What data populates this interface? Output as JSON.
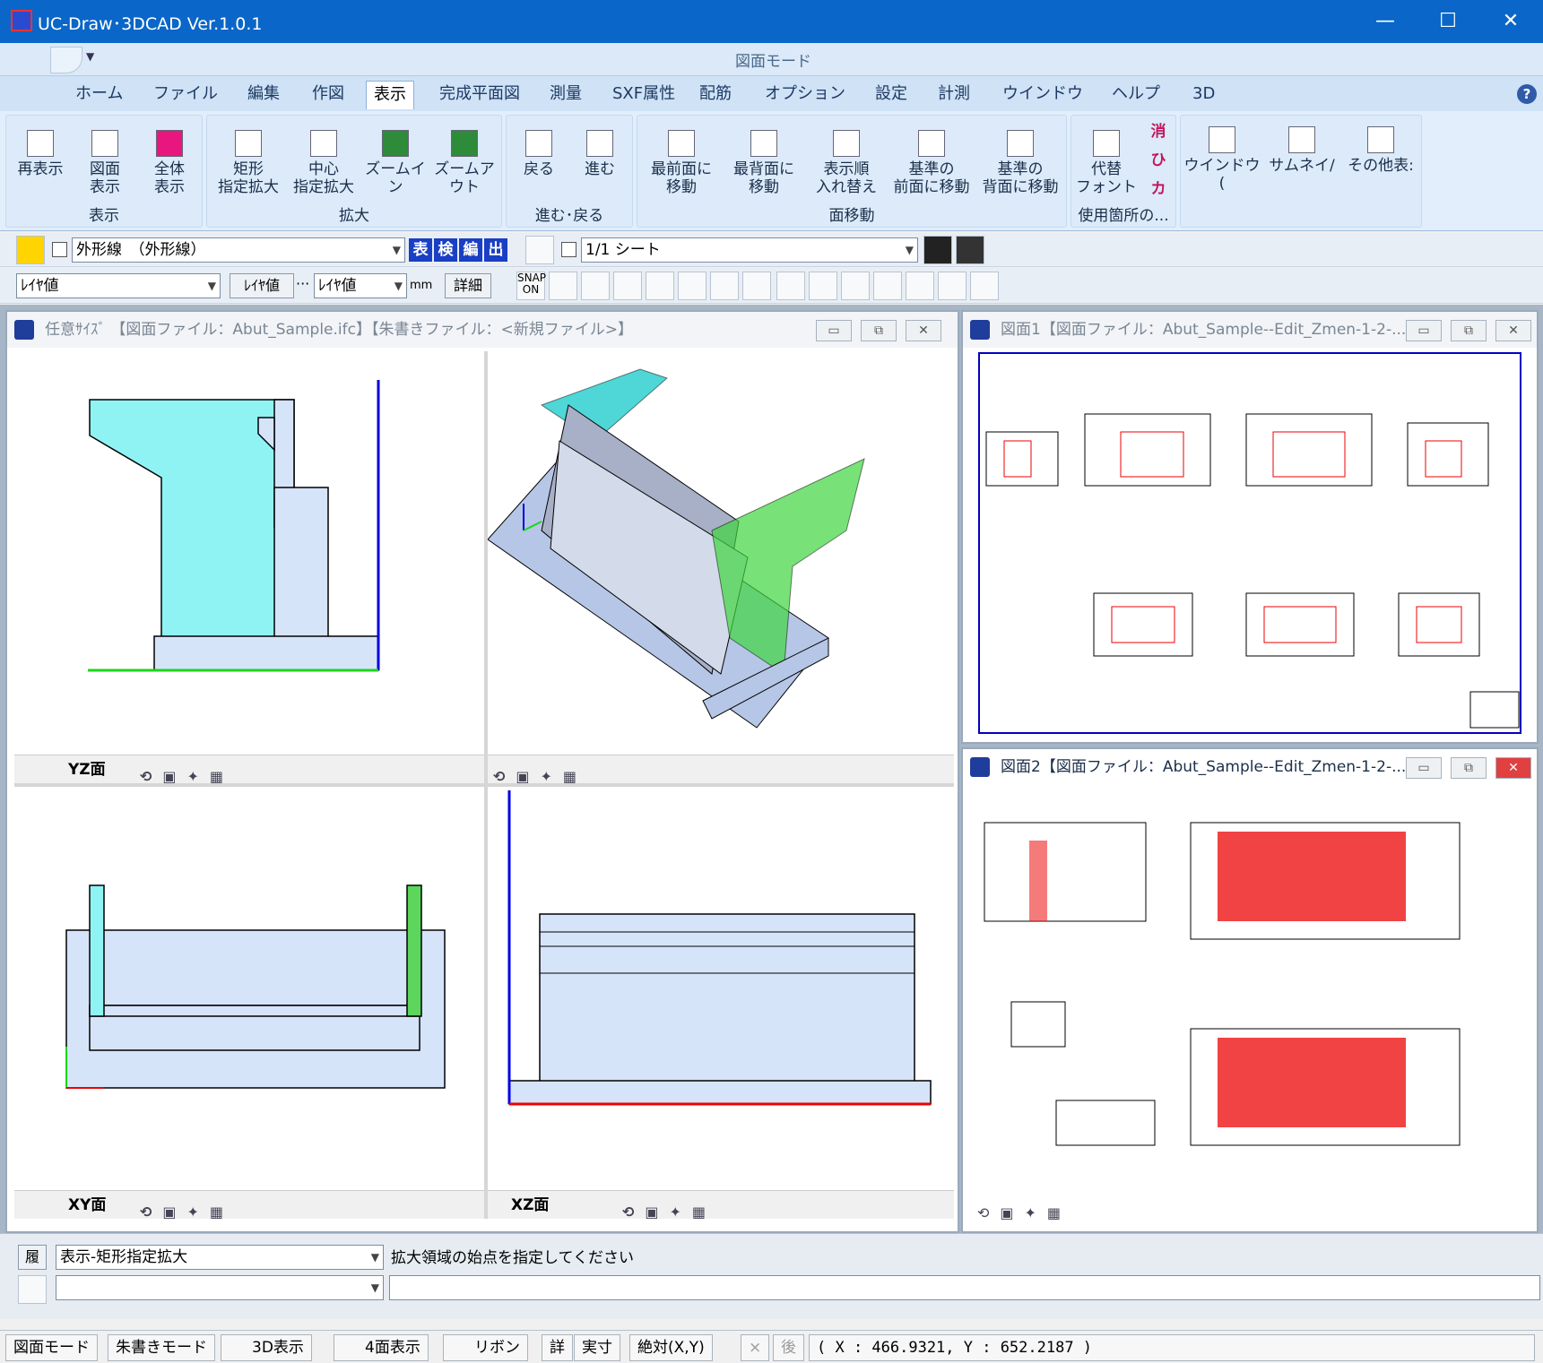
{
  "app": {
    "title": "UC-Draw･3DCAD Ver.1.0.1"
  },
  "window_controls": {
    "minimize": "—",
    "maximize": "☐",
    "close": "✕"
  },
  "mode_caption": "図面モード",
  "tabs": [
    "ホーム",
    "ファイル",
    "編集",
    "作図",
    "表示",
    "完成平面図",
    "測量",
    "SXF属性",
    "配筋",
    "オプション",
    "設定",
    "計測",
    "ウインドウ",
    "ヘルプ",
    "3D"
  ],
  "active_tab": "表示",
  "ribbon": {
    "group1": {
      "label": "表示",
      "buttons": [
        "再表示",
        "図面\n表示",
        "全体\n表示"
      ]
    },
    "group2": {
      "label": "拡大",
      "buttons": [
        "矩形\n指定拡大",
        "中心\n指定拡大",
        "ズームイ\nン",
        "ズームア\nウト"
      ]
    },
    "group3": {
      "label": "進む･戻る",
      "buttons": [
        "戻る",
        "進む"
      ]
    },
    "group4": {
      "label": "面移動",
      "buttons": [
        "最前面に\n移動",
        "最背面に\n移動",
        "表示順\n入れ替え",
        "基準の\n前面に移動",
        "基準の\n背面に移動"
      ]
    },
    "group5": {
      "label": "使用箇所の...",
      "buttons": [
        "代替\nフォント"
      ],
      "side": [
        "消",
        "ひ",
        "カ"
      ]
    },
    "group6": {
      "buttons": [
        "ウインドウ(",
        "サムネイ/",
        "その他表:"
      ]
    }
  },
  "layer_combo": "外形線　（外形線）",
  "layer_buttons": [
    "表",
    "検",
    "編",
    "出"
  ],
  "sheet_combo": "1/1 シート",
  "attr": {
    "line_type": "ﾚｲﾔ値",
    "color": "ﾚｲﾔ値",
    "width": "ﾚｲﾔ値",
    "unit": "mm",
    "detail": "詳細",
    "snap": "SNAP\nON",
    "dots": "···"
  },
  "win_main": {
    "title": "任意ｻｲｽﾞ 【図面ファイル：Abut_Sample.ifc】【朱書きファイル：<新規ファイル>】",
    "views": {
      "yz": "YZ面",
      "xy": "XY面",
      "xz": "XZ面"
    }
  },
  "win_d1": {
    "title": "図面1【図面ファイル：Abut_Sample--Edit_Zmen-1-2-...."
  },
  "win_d2": {
    "title": "図面2【図面ファイル：Abut_Sample--Edit_Zmen-1-2-...."
  },
  "cmd": {
    "history_label": "履",
    "history_value": "表示-矩形指定拡大",
    "prompt": "拡大領域の始点を指定してください"
  },
  "status": {
    "items": [
      "図面モード",
      "朱書きモード",
      "3D表示",
      "4面表示",
      "リボン",
      "詳",
      "実寸",
      "絶対(X,Y)",
      "×",
      "後"
    ],
    "coords": "( X : 466.9321, Y : 652.2187 )"
  }
}
